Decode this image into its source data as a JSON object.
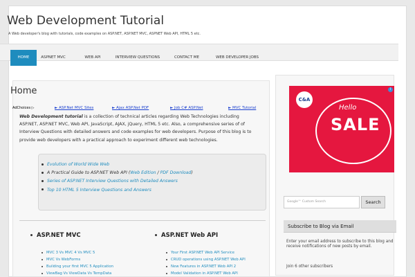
{
  "site": {
    "title": "Web Development Tutorial",
    "description": "A Web developer's blog with tutorials, code examples on ASP.NET, ASP.NET MVC, ASPNET Web API, HTML 5 etc."
  },
  "nav": {
    "items": [
      {
        "label": "HOME",
        "active": true
      },
      {
        "label": "ASPNET MVC",
        "active": false
      },
      {
        "label": "WEB API",
        "active": false
      },
      {
        "label": "INTERVIEW QUESTIONS",
        "active": false
      },
      {
        "label": "CONTACT ME",
        "active": false
      },
      {
        "label": "WEB DEVELOPER JOBS",
        "active": false
      }
    ]
  },
  "main": {
    "title": "Home",
    "adchoices": "AdChoices ▷",
    "ad_links": [
      "► ASP.Net MVC Sites",
      "► Ajax ASP.Net PDF",
      "► Job C# ASP.Net",
      "► MVC Tutorial"
    ],
    "intro_bold": "Web Development tutorial",
    "intro_text": " is a collection of technical articles regarding Web Technologies including ASP.NET, ASP.NET MVC, Web API, JavaScript, AJAX, jQuery, HTML 5 etc. Also, a comprehensive series of of Interview Questions with detailed answers and code examples for web developers. Purpose of this blog is to provide web developers with a practical approach to experiment different web technologies.",
    "tutorials": {
      "evolution": "Evolution of World Wide Web",
      "guide_prefix": "A Practical Guide to ASP.NET Web API (",
      "web_edition": "Web Edition",
      "sep": " / ",
      "pdf_download": "PDF Download",
      "guide_suffix": ")",
      "series": "Series of ASP.NET Interview Questions with Detailed Answers",
      "top10": "Top 10 HTML 5 Interview Questions and Answers"
    },
    "columns": [
      {
        "heading": "ASP.NET MVC",
        "links": [
          "MVC 3 Vs MVC 4 Vs MVC 5",
          "MVC Vs WebForms",
          "Building your first MVC 5 Application",
          "ViewBag Vs ViewData Vs TempData"
        ]
      },
      {
        "heading": "ASP.NET Web API",
        "links": [
          "Your First ASP.NET Web API Service",
          "CRUD operations using ASP.NET Web API",
          "New Features in ASP.NET Web API 2",
          "Model Validation in ASP.NET Web API"
        ]
      }
    ]
  },
  "sidebar": {
    "ad": {
      "brand": "C&A",
      "hello": "Hello",
      "sale": "SALE",
      "info": "i"
    },
    "search": {
      "placeholder": "Google™ Custom Search",
      "button": "Search"
    },
    "subscribe": {
      "heading": "Subscribe to Blog via Email",
      "text": "Enter your email address to subscribe to this blog and receive notifications of new posts by email.",
      "count": "Join 6 other subscribers"
    }
  },
  "colors": {
    "accent": "#1e8cbe",
    "ad_red": "#e5173f",
    "link_blue": "#1a3fcf"
  }
}
